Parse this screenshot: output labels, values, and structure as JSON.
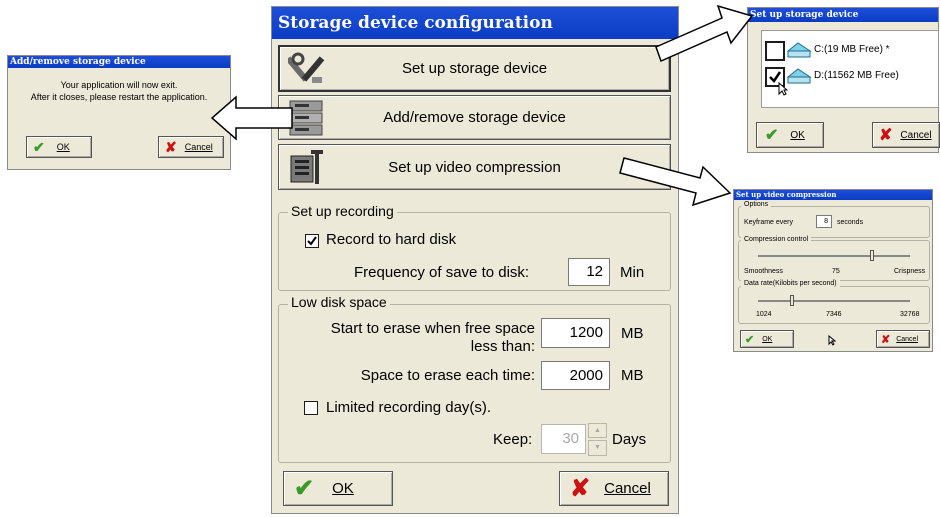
{
  "main": {
    "title": "Storage device configuration",
    "menu": [
      {
        "label": "Set up storage device"
      },
      {
        "label": "Add/remove storage device"
      },
      {
        "label": "Set up video compression"
      }
    ],
    "recording": {
      "legend": "Set up recording",
      "record_label": "Record to hard disk",
      "record_checked": true,
      "freq_label": "Frequency of save to disk:",
      "freq_value": "12",
      "freq_unit": "Min"
    },
    "lowdisk": {
      "legend": "Low disk space",
      "start_label_1": "Start to erase when free space",
      "start_label_2": "less than:",
      "start_value": "1200",
      "start_unit": "MB",
      "erase_label": "Space to erase each time:",
      "erase_value": "2000",
      "erase_unit": "MB",
      "limited_label": "Limited recording day(s).",
      "limited_checked": false,
      "keep_label": "Keep:",
      "keep_value": "30",
      "keep_unit": "Days"
    },
    "ok_label": "OK",
    "cancel_label": "Cancel"
  },
  "addremove": {
    "title": "Add/remove storage device",
    "line1": "Your application will now exit.",
    "line2": "After it closes, please restart the application.",
    "ok_label": "OK",
    "cancel_label": "Cancel"
  },
  "storage": {
    "title": "Set up storage device",
    "devices": [
      {
        "label": "C:(19 MB Free) *",
        "checked": false
      },
      {
        "label": "D:(11562 MB Free)",
        "checked": true
      }
    ],
    "ok_label": "OK",
    "cancel_label": "Cancel"
  },
  "compression": {
    "title": "Set up video compression",
    "options_legend": "Options",
    "keyframe_label": "Keyframe every",
    "keyframe_value": "8",
    "keyframe_unit": "seconds",
    "control_legend": "Compression control",
    "smoothness": "Smoothness",
    "control_value": "75",
    "crispness": "Crispness",
    "control_level": 0.75,
    "datarate_legend": "Data rate(Kilobits per second)",
    "rate_min": "1024",
    "rate_value": "7346",
    "rate_max": "32768",
    "ok_label": "OK",
    "cancel_label": "Cancel"
  },
  "icons": {
    "ok": "checkmark-icon",
    "cancel": "red-x-icon",
    "tools": "tools-icon",
    "drives": "drive-stack-icon",
    "compress": "compression-icon"
  },
  "colors": {
    "title_blue": "#0a3cc4",
    "ok_green": "#3b9b2a",
    "cancel_red": "#cc1111",
    "window_bg": "#ece9d8"
  }
}
